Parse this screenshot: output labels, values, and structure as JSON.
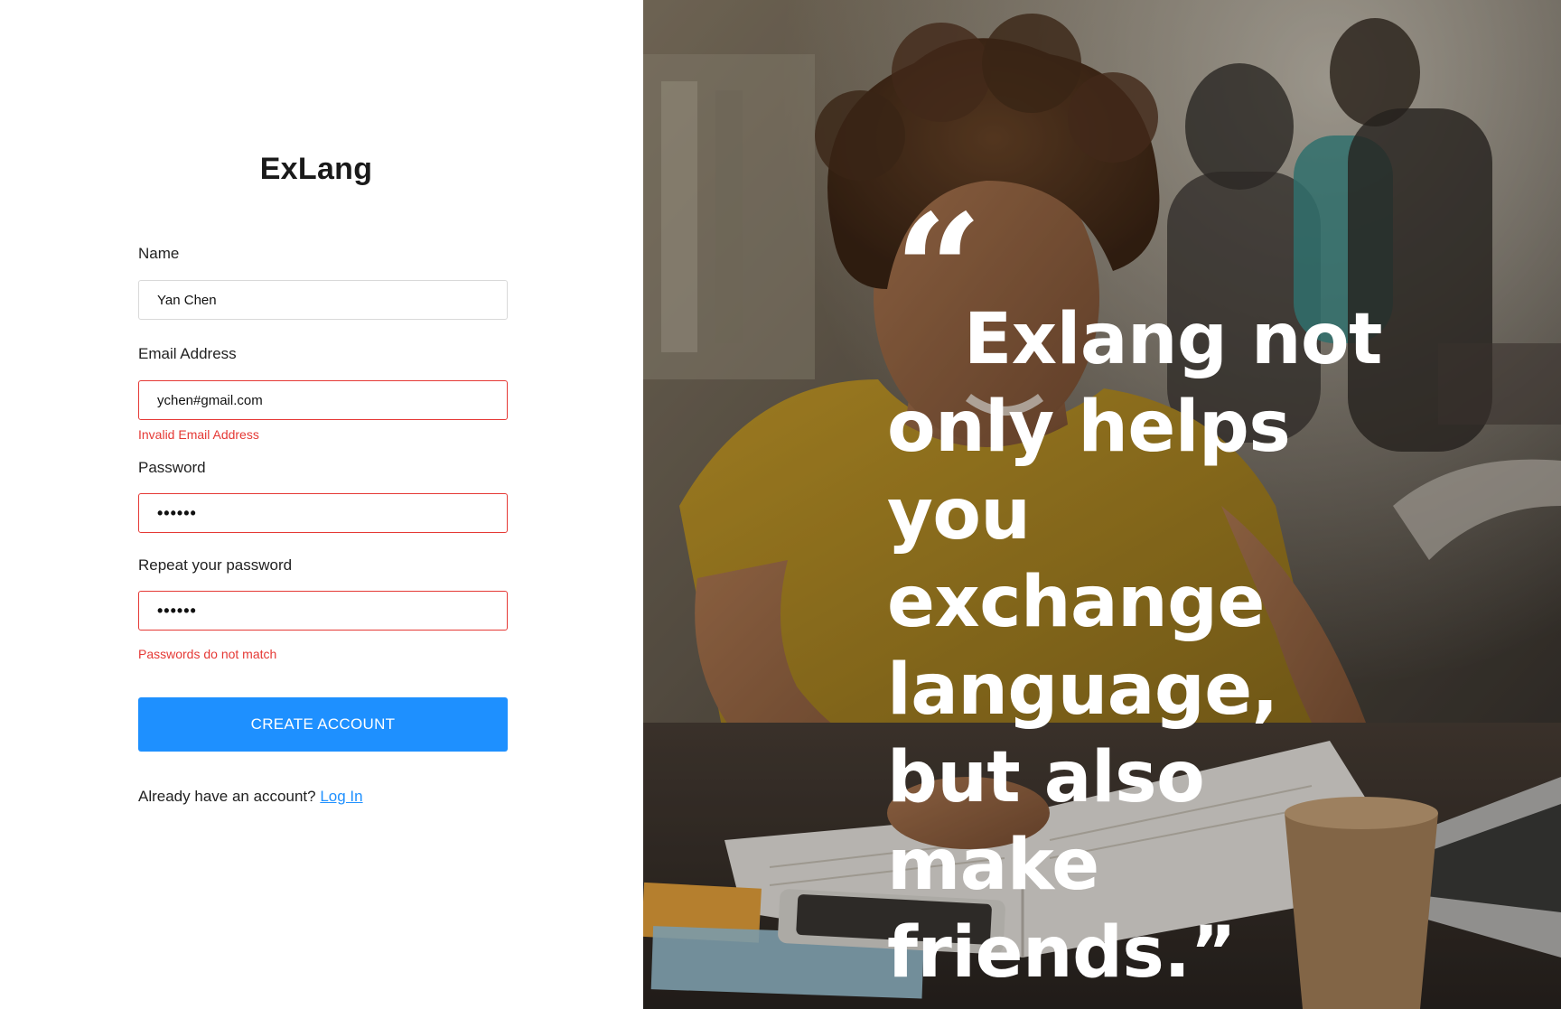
{
  "brand": {
    "name": "ExLang"
  },
  "form": {
    "name": {
      "label": "Name",
      "value": "Yan Chen"
    },
    "email": {
      "label": "Email Address",
      "value": "ychen#gmail.com",
      "error": "Invalid Email Address"
    },
    "password": {
      "label": "Password",
      "value": "••••••"
    },
    "repeat_password": {
      "label": "Repeat your password",
      "value": "••••••",
      "error": "Passwords do not match"
    },
    "submit_label": "CREATE ACCOUNT",
    "login_prompt": "Already have an account?",
    "login_link": "Log In"
  },
  "hero": {
    "quote_mark": "“",
    "quote": "Exlang not only helps you exchange language, but also make friends.”"
  },
  "colors": {
    "accent": "#1E90FF",
    "error": "#E53935",
    "text": "#222222"
  }
}
